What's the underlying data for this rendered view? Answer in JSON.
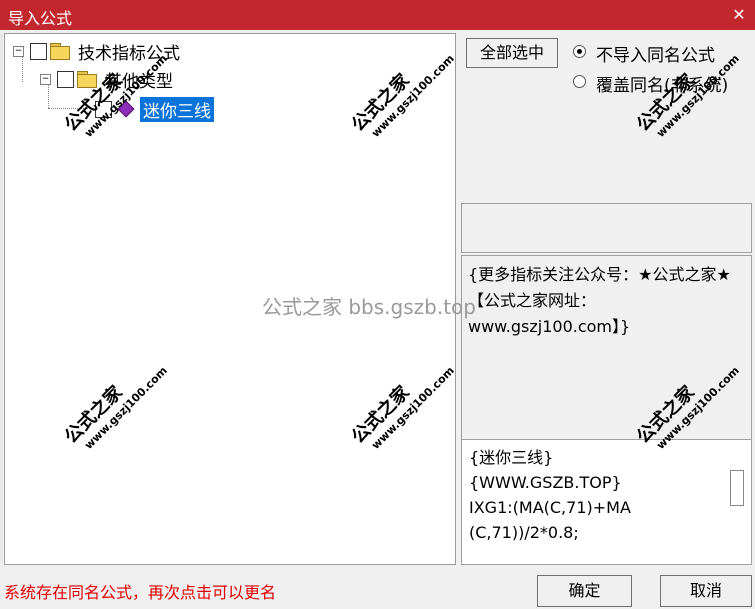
{
  "window": {
    "title": "导入公式",
    "close_glyph": "✕"
  },
  "tree": {
    "nodes": [
      {
        "label": "技术指标公式",
        "icon": "folder-icon",
        "expander": "−"
      },
      {
        "label": "其他类型",
        "icon": "folder-icon",
        "expander": "−"
      },
      {
        "label": "迷你三线",
        "icon": "formula-diamond-icon",
        "selected": true
      }
    ]
  },
  "actions": {
    "select_all_label": "全部选中",
    "radio_no_import": "不导入同名公式",
    "radio_overwrite": "覆盖同名(非系统)",
    "ok_label": "确定",
    "cancel_label": "取消"
  },
  "info": {
    "text": "{更多指标关注公众号：★公式之家★ 【公式之家网址：www.gszj100.com】}"
  },
  "code": {
    "text": "{迷你三线}\n{WWW.GSZB.TOP}\nIXG1:(MA(C,71)+MA\n(C,71))/2*0.8;"
  },
  "status": {
    "message": "系统存在同名公式，再次点击可以更名"
  },
  "watermarks": {
    "brand": "公式之家",
    "url": "www.gszj100.com",
    "center": "公式之家 bbs.gszb.top"
  },
  "colors": {
    "titlebar": "#c1272d",
    "selection": "#0a74da",
    "status_text": "#e00000"
  }
}
